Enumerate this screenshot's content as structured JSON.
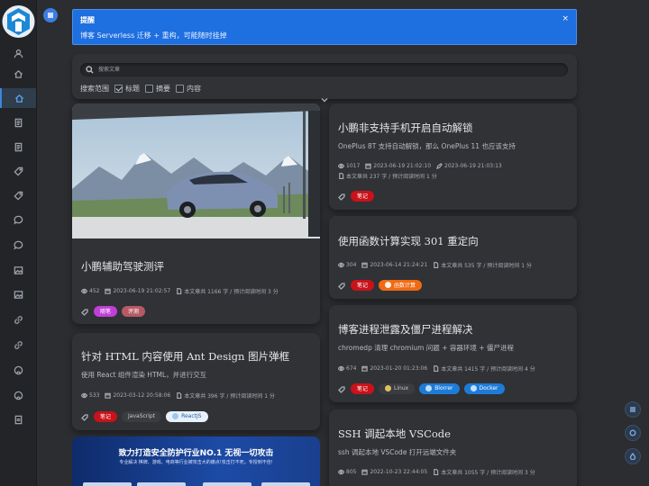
{
  "notice": {
    "title": "提醒",
    "body": "博客 Serverless 迁移 + 重构，可能随时挂掉",
    "close": "×"
  },
  "search": {
    "placeholder": "搜索文章",
    "scope_label": "搜索范围",
    "options": [
      {
        "label": "标题",
        "checked": true
      },
      {
        "label": "摘要",
        "checked": false
      },
      {
        "label": "内容",
        "checked": false
      }
    ]
  },
  "posts": {
    "p1": {
      "title": "小鹏辅助驾驶测评",
      "views": "452",
      "date": "2023-06-19 21:02:57",
      "words": "本文章共 1166 字 / 预计阅读时间 3 分",
      "tags": [
        {
          "label": "随笔",
          "color": "#c13fd8"
        },
        {
          "label": "评测",
          "color": "#b65a65"
        }
      ]
    },
    "p2": {
      "title": "针对 HTML 内容使用 Ant Design 图片弹框",
      "desc": "使用 React 组件渲染 HTML，并进行交互",
      "views": "533",
      "date": "2023-03-12 20:58:06",
      "words": "本文章共 396 字 / 预计阅读时间 1 分",
      "tags": [
        {
          "label": "笔记",
          "color": "#c9121a"
        },
        {
          "label": "JavaScript",
          "color": "#3a3c40"
        },
        {
          "label": "ReactJS",
          "color": "#e8f1fb"
        }
      ]
    },
    "p3": {
      "title": "小鹏非支持手机开启自动解锁",
      "desc": "OnePlus 8T 支持自动解锁，那么 OnePlus 11 也应该支持",
      "views": "1017",
      "date": "2023-06-19 21:02:10",
      "updated": "2023-06-19 21:03:13",
      "words": "本文章共 237 字 / 预计阅读时间 1 分",
      "tags": [
        {
          "label": "笔记",
          "color": "#c9121a"
        }
      ]
    },
    "p4": {
      "title": "使用函数计算实现 301 重定向",
      "views": "304",
      "date": "2023-06-14 21:24:21",
      "words": "本文章共 535 字 / 预计阅读时间 1 分",
      "tags": [
        {
          "label": "笔记",
          "color": "#c9121a"
        },
        {
          "label": "函数计算",
          "color": "#f06a12"
        }
      ]
    },
    "p5": {
      "title": "博客进程泄露及僵尸进程解决",
      "desc": "chromedp 清理 chromium 问题 + 容器环境 + 僵尸进程",
      "views": "674",
      "date": "2023-01-20 01:23:06",
      "words": "本文章共 1415 字 / 预计阅读时间 4 分",
      "tags": [
        {
          "label": "笔记",
          "color": "#c9121a"
        },
        {
          "label": "Linux",
          "color": "#3a3c40"
        },
        {
          "label": "Blorrer",
          "color": "#1e7bd8"
        },
        {
          "label": "Docker",
          "color": "#1e7bd8"
        }
      ]
    },
    "p6": {
      "title": "SSH 调起本地 VSCode",
      "desc": "ssh 调起本地 VSCode 打开远端文件夹",
      "views": "805",
      "date": "2022-10-23 22:44:05",
      "words": "本文章共 1055 字 / 预计阅读时间 3 分"
    }
  },
  "ad": {
    "title": "致力打造安全防护行业NO.1 无视一切攻击",
    "subtitle": "专业解决 棋牌、游戏、电商等行业被攻击大的痛点!攻击打不死，专授到不佳!"
  }
}
